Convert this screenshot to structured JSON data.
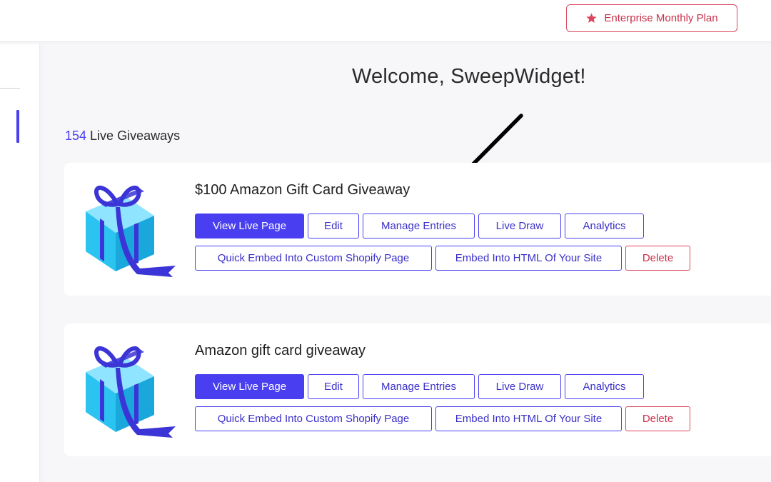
{
  "header": {
    "plan_button_label": "Enterprise Monthly Plan",
    "plan_icon": "star-icon",
    "accent_color": "#d9475c"
  },
  "main": {
    "welcome_text": "Welcome, SweepWidget!",
    "live_count": "154",
    "live_label": " Live Giveaways"
  },
  "giveaways": [
    {
      "title": "$100 Amazon Gift Card Giveaway",
      "icon": "gift-box-icon",
      "buttons": {
        "view_live_page": "View Live Page",
        "edit": "Edit",
        "manage_entries": "Manage Entries",
        "live_draw": "Live Draw",
        "analytics": "Analytics",
        "quick_embed_shopify": "Quick Embed Into Custom Shopify Page",
        "embed_html": "Embed Into HTML Of Your Site",
        "delete": "Delete"
      }
    },
    {
      "title": "Amazon gift card giveaway",
      "icon": "gift-box-icon",
      "buttons": {
        "view_live_page": "View Live Page",
        "edit": "Edit",
        "manage_entries": "Manage Entries",
        "live_draw": "Live Draw",
        "analytics": "Analytics",
        "quick_embed_shopify": "Quick Embed Into Custom Shopify Page",
        "embed_html": "Embed Into HTML Of Your Site",
        "delete": "Delete"
      }
    }
  ],
  "colors": {
    "primary": "#4a3ff0",
    "danger": "#d9475c",
    "gift_box": "#2bc4f0",
    "ribbon": "#3b34d6"
  }
}
